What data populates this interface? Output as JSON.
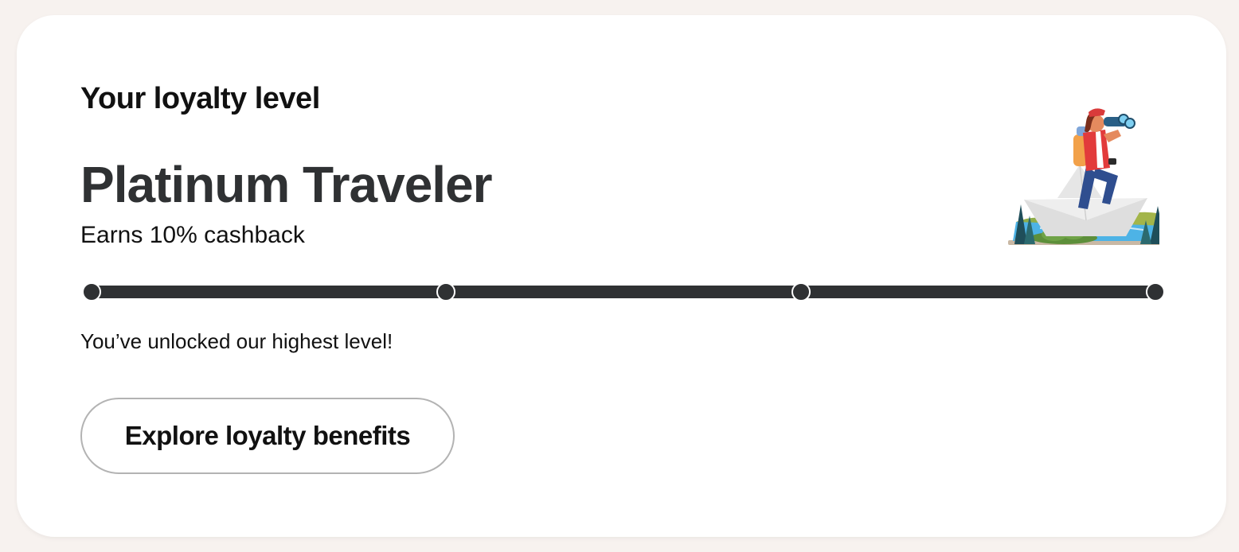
{
  "loyalty": {
    "heading": "Your loyalty level",
    "tier_name": "Platinum Traveler",
    "tier_perk": "Earns 10% cashback",
    "status_message": "You’ve unlocked our highest level!",
    "cta_label": "Explore loyalty benefits"
  },
  "progress": {
    "fraction": 1.0,
    "milestones": 4,
    "current_milestone": 4
  },
  "illustration": {
    "icon": "traveler-with-binoculars-on-paper-boat-icon"
  },
  "colors": {
    "page_background": "#f7f2ef",
    "card_background": "#ffffff",
    "progress_fill": "#2f3133",
    "text_primary": "#111111",
    "tier_text": "#2f3133",
    "button_border": "#b3b3b3"
  }
}
